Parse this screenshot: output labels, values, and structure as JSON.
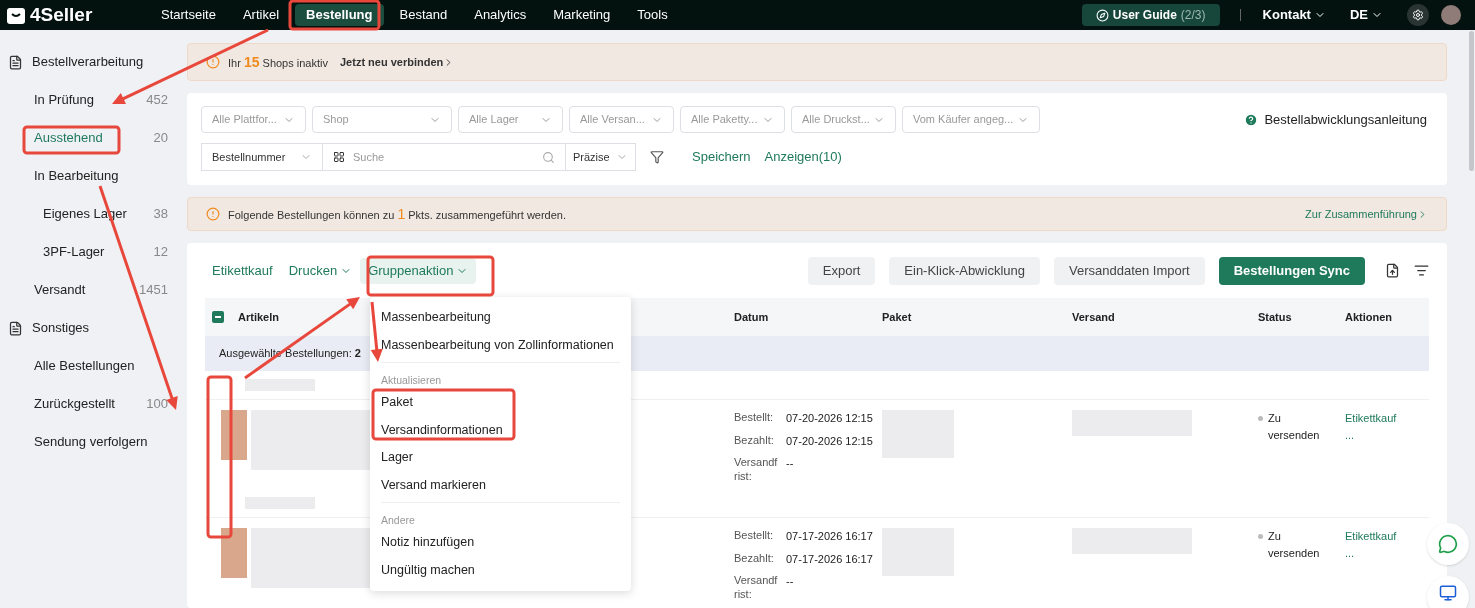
{
  "logo": "4Seller",
  "nav": [
    {
      "label": "Startseite",
      "selected": false
    },
    {
      "label": "Artikel",
      "selected": false
    },
    {
      "label": "Bestellung",
      "selected": true
    },
    {
      "label": "Bestand",
      "selected": false
    },
    {
      "label": "Analytics",
      "selected": false
    },
    {
      "label": "Marketing",
      "selected": false
    },
    {
      "label": "Tools",
      "selected": false
    }
  ],
  "user_guide": {
    "label": "User Guide",
    "progress": "(2/3)"
  },
  "header_menus": [
    "Kontakt",
    "DE"
  ],
  "sidebar": [
    {
      "label": "Bestellverarbeitung",
      "children": [
        {
          "label": "In Prüfung",
          "count": "452",
          "selected": false
        },
        {
          "label": "Ausstehend",
          "count": "20",
          "selected": true
        },
        {
          "label": "In Bearbeitung",
          "selected": false,
          "children": [
            {
              "label": "Eigenes Lager",
              "count": "38",
              "selected": false
            },
            {
              "label": "3PF-Lager",
              "count": "12",
              "selected": false
            }
          ]
        },
        {
          "label": "Versandt",
          "count": "1451",
          "selected": false
        }
      ]
    },
    {
      "label": "Sonstiges",
      "children": [
        {
          "label": "Alle Bestellungen",
          "selected": false
        },
        {
          "label": "Zurückgestellt",
          "count": "100",
          "selected": false
        },
        {
          "label": "Sendung verfolgern",
          "selected": false
        }
      ]
    }
  ],
  "shop_alert": {
    "before": "Ihr",
    "count": "15",
    "after": "Shops inaktiv",
    "link": "Jetzt neu verbinden"
  },
  "filters": [
    "Alle Plattfor...",
    "Shop",
    "Alle Lager",
    "Alle Versan...",
    "Alle Paketty...",
    "Alle Druckst...",
    "Vom Käufer angeg..."
  ],
  "guide_link": "Bestellabwicklungsanleitung",
  "search": {
    "field": "Bestellnummer",
    "placeholder": "Suche",
    "mode": "Präzise"
  },
  "filter_actions": [
    "Speichern",
    "Anzeigen(10)"
  ],
  "merge_alert": {
    "before": "Folgende Bestellungen können zu",
    "count": "1",
    "after": "Pkts. zusammengeführt werden.",
    "link": "Zur Zusammenführung"
  },
  "toolbar": {
    "links": [
      {
        "label": "Etikettkauf",
        "dropdown": false
      },
      {
        "label": "Drucken",
        "dropdown": true
      },
      {
        "label": "Gruppenaktion",
        "dropdown": true,
        "open": true
      }
    ],
    "buttons": [
      {
        "label": "Export",
        "primary": false
      },
      {
        "label": "Ein-Klick-Abwicklung",
        "primary": false
      },
      {
        "label": "Versanddaten Import",
        "primary": false
      },
      {
        "label": "Bestellungen Sync",
        "primary": true
      }
    ]
  },
  "table": {
    "select_all_partial": true,
    "columns": [
      "Artikeln",
      "Datum",
      "Paket",
      "Versand",
      "Status",
      "Aktionen"
    ],
    "selected_label": "Ausgewählte Bestellungen:",
    "selected_count": "2",
    "rows": [
      {
        "labels": [
          "Bestellt:",
          "Bezahlt:",
          "Versandfrist:"
        ],
        "ordered": "07-20-2026 12:15",
        "paid": "07-20-2026 12:15",
        "deadline": "--",
        "status": "Zu versenden",
        "action": "Etikettkauf",
        "more": "..."
      },
      {
        "labels": [
          "Bestellt:",
          "Bezahlt:",
          "Versandfrist:"
        ],
        "ordered": "07-17-2026 16:17",
        "paid": "07-17-2026 16:17",
        "deadline": "--",
        "status": "Zu versenden",
        "action": "Etikettkauf",
        "more": "..."
      }
    ]
  },
  "dropdown": [
    {
      "kind": "item",
      "label": "Massenbearbeitung"
    },
    {
      "kind": "item",
      "label": "Massenbearbeitung von Zollinformationen"
    },
    {
      "kind": "divider"
    },
    {
      "kind": "heading",
      "label": "Aktualisieren"
    },
    {
      "kind": "item",
      "label": "Paket"
    },
    {
      "kind": "item",
      "label": "Versandinformationen"
    },
    {
      "kind": "item",
      "label": "Lager"
    },
    {
      "kind": "item",
      "label": "Versand markieren"
    },
    {
      "kind": "divider"
    },
    {
      "kind": "heading",
      "label": "Andere"
    },
    {
      "kind": "item",
      "label": "Notiz hinzufügen"
    },
    {
      "kind": "item",
      "label": "Ungültig machen"
    }
  ]
}
